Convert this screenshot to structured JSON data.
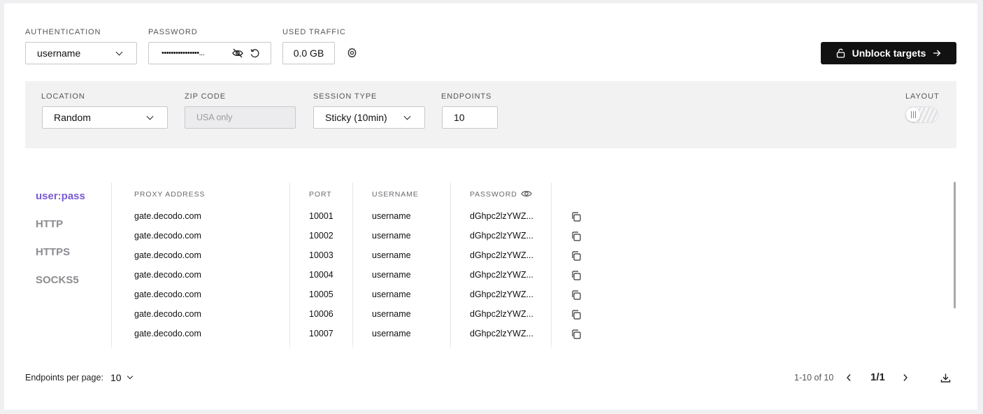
{
  "auth": {
    "label": "AUTHENTICATION",
    "value": "username"
  },
  "password": {
    "label": "PASSWORD",
    "value": "••••••••••••••••..."
  },
  "traffic": {
    "label": "USED TRAFFIC",
    "value": "0.0 GB"
  },
  "unblock": {
    "label": "Unblock targets"
  },
  "filters": {
    "location": {
      "label": "LOCATION",
      "value": "Random"
    },
    "zip": {
      "label": "ZIP CODE",
      "placeholder": "USA only"
    },
    "session": {
      "label": "SESSION TYPE",
      "value": "Sticky (10min)"
    },
    "endpoints": {
      "label": "ENDPOINTS",
      "value": "10"
    },
    "layout": {
      "label": "LAYOUT"
    }
  },
  "tabs": [
    "user:pass",
    "HTTP",
    "HTTPS",
    "SOCKS5"
  ],
  "table": {
    "headers": {
      "address": "PROXY ADDRESS",
      "port": "PORT",
      "username": "USERNAME",
      "password": "PASSWORD"
    },
    "rows": [
      {
        "address": "gate.decodo.com",
        "port": "10001",
        "username": "username",
        "password": "dGhpc2lzYWZ..."
      },
      {
        "address": "gate.decodo.com",
        "port": "10002",
        "username": "username",
        "password": "dGhpc2lzYWZ..."
      },
      {
        "address": "gate.decodo.com",
        "port": "10003",
        "username": "username",
        "password": "dGhpc2lzYWZ..."
      },
      {
        "address": "gate.decodo.com",
        "port": "10004",
        "username": "username",
        "password": "dGhpc2lzYWZ..."
      },
      {
        "address": "gate.decodo.com",
        "port": "10005",
        "username": "username",
        "password": "dGhpc2lzYWZ..."
      },
      {
        "address": "gate.decodo.com",
        "port": "10006",
        "username": "username",
        "password": "dGhpc2lzYWZ..."
      },
      {
        "address": "gate.decodo.com",
        "port": "10007",
        "username": "username",
        "password": "dGhpc2lzYWZ..."
      }
    ]
  },
  "footer": {
    "per_page_label": "Endpoints per page:",
    "per_page_value": "10",
    "range": "1-10 of 10",
    "page": "1/1"
  },
  "colors": {
    "accent": "#7a5ad6",
    "dark": "#111111",
    "panel": "#f2f2f3"
  }
}
